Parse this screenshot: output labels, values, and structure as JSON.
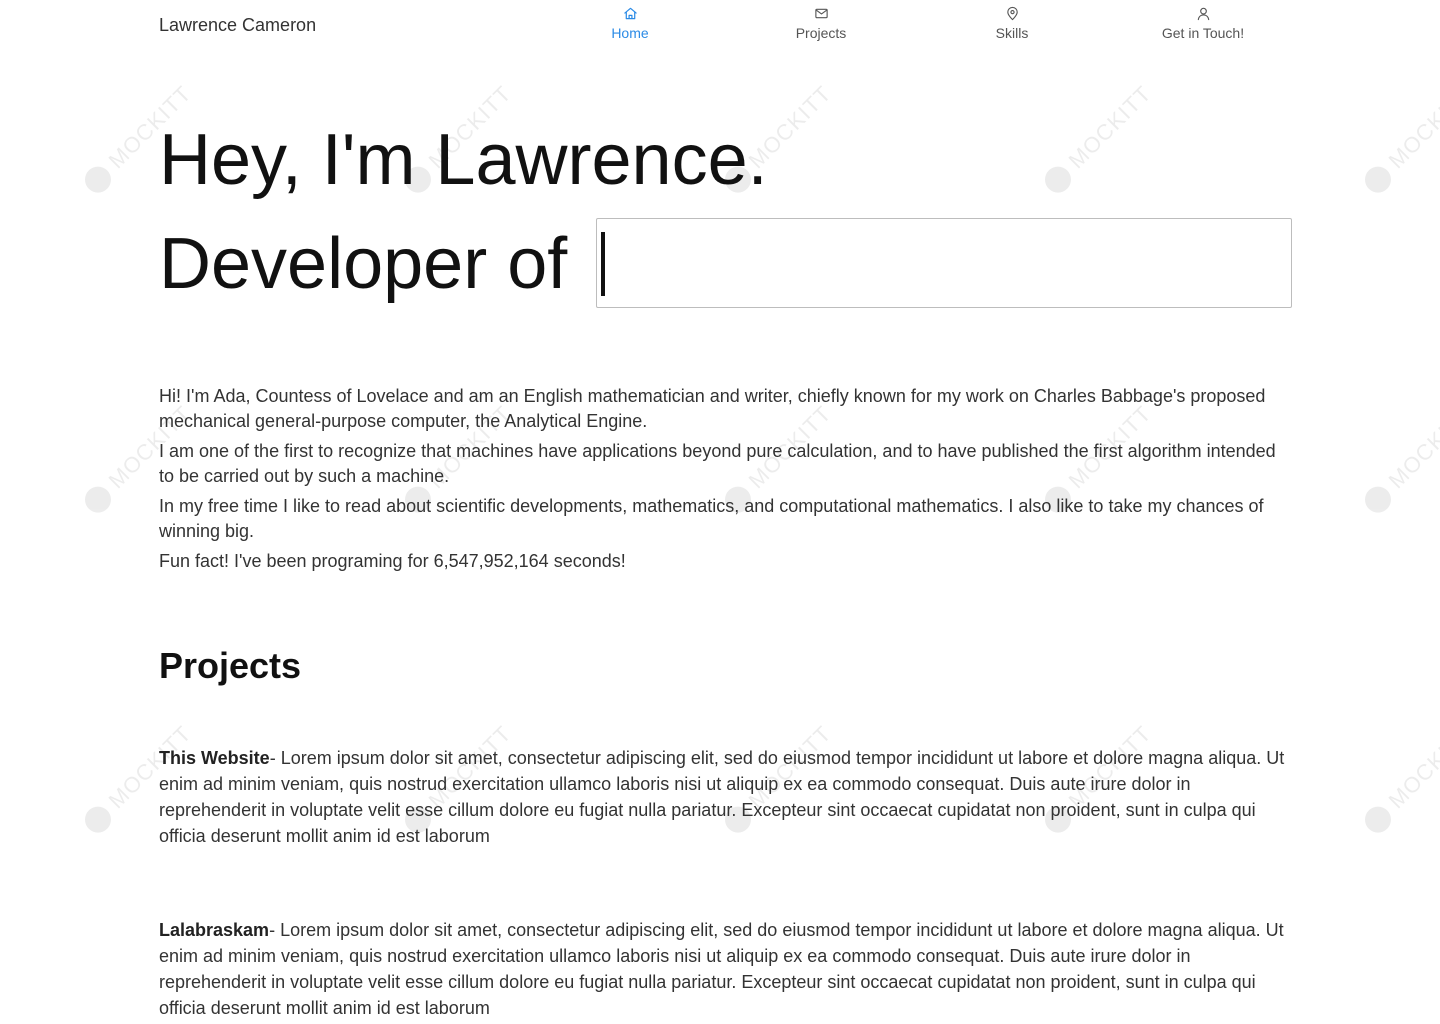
{
  "header": {
    "brand": "Lawrence Cameron",
    "nav": [
      {
        "label": "Home",
        "icon": "home-icon",
        "active": true
      },
      {
        "label": "Projects",
        "icon": "mail-icon",
        "active": false
      },
      {
        "label": "Skills",
        "icon": "location-pin-icon",
        "active": false
      },
      {
        "label": "Get in Touch!",
        "icon": "user-icon",
        "active": false
      }
    ]
  },
  "hero": {
    "title": "Hey, I'm Lawrence.",
    "typed_prefix": "Developer of",
    "typed_value": ""
  },
  "about": {
    "paragraphs": [
      "Hi! I'm Ada, Countess of Lovelace and am an English mathematician and writer, chiefly known for my work on Charles Babbage's proposed mechanical general-purpose computer, the Analytical Engine.",
      "I am one of the first to recognize that machines have applications beyond pure calculation, and to have published the first algorithm intended to be carried out by such a machine.",
      "In my free time I like to read about scientific developments, mathematics, and computational mathematics. I also like to take my chances of winning big.",
      "Fun fact! I've been programing for 6,547,952,164 seconds!"
    ]
  },
  "projects": {
    "heading": "Projects",
    "items": [
      {
        "name": "This Website",
        "description": "- Lorem ipsum dolor sit amet, consectetur adipiscing elit, sed do eiusmod tempor incididunt ut labore et dolore magna aliqua. Ut enim ad minim veniam, quis nostrud exercitation ullamco laboris nisi ut aliquip ex ea commodo consequat. Duis aute irure dolor in reprehenderit in voluptate velit esse cillum dolore eu fugiat nulla pariatur. Excepteur sint occaecat cupidatat non proident, sunt in culpa qui officia deserunt mollit anim id est laborum"
      },
      {
        "name": "Lalabraskam",
        "description": "- Lorem ipsum dolor sit amet, consectetur adipiscing elit, sed do eiusmod tempor incididunt ut labore et dolore magna aliqua. Ut enim ad minim veniam, quis nostrud exercitation ullamco laboris nisi ut aliquip ex ea commodo consequat. Duis aute irure dolor in reprehenderit in voluptate velit esse cillum dolore eu fugiat nulla pariatur. Excepteur sint occaecat cupidatat non proident, sunt in culpa qui officia deserunt mollit anim id est laborum"
      }
    ]
  },
  "watermark": {
    "text": "MOCKITT"
  },
  "colors": {
    "accent": "#2c8be6",
    "text": "#333333",
    "heading": "#111111",
    "nav_text": "#555555"
  }
}
